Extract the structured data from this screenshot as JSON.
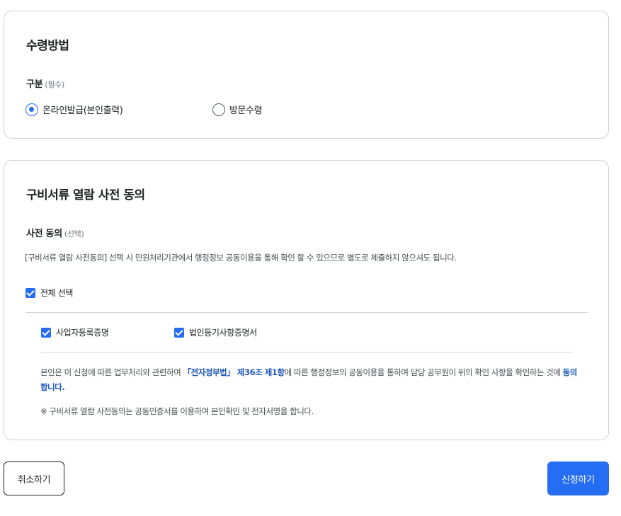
{
  "receipt": {
    "title": "수령방법",
    "field_label": "구분",
    "field_required": "(필수)",
    "options": [
      {
        "label": "온라인발급(본인출력)",
        "selected": true
      },
      {
        "label": "방문수령",
        "selected": false
      }
    ]
  },
  "consent": {
    "title": "구비서류 열람 사전 동의",
    "field_label": "사전 동의",
    "field_optional": "(선택)",
    "description": "[구비서류 열람 사전동의] 선택 시 민원처리기관에서 행정정보 공동이용을 통해 확인 할 수 있으므로 별도로 제출하지 않으셔도 됩니다.",
    "select_all": {
      "label": "전체 선택",
      "checked": true
    },
    "documents": [
      {
        "label": "사업자등록증명",
        "checked": true
      },
      {
        "label": "법인등기사항증명서",
        "checked": true
      }
    ],
    "agreement": {
      "part1": "본인은 이 신청에 따른 업무처리와 관련하여 ",
      "law": "「전자정부법」 제36조 제1항",
      "part2": "에 따른 행정정보의 공동이용을 통하여 담당 공무원이 위의 확인 사항을 확인하는 것에 ",
      "agree": "동의합니다."
    },
    "note": "※ 구비서류 열람 사전동의는 공동인증서를 이용하여 본인확인 및 전자서명을 합니다."
  },
  "buttons": {
    "cancel": "취소하기",
    "apply": "신청하기"
  },
  "colors": {
    "primary": "#256ef4",
    "emphasis": "#1d56bc",
    "border": "#cdd1d5",
    "text": "#1e2124"
  }
}
